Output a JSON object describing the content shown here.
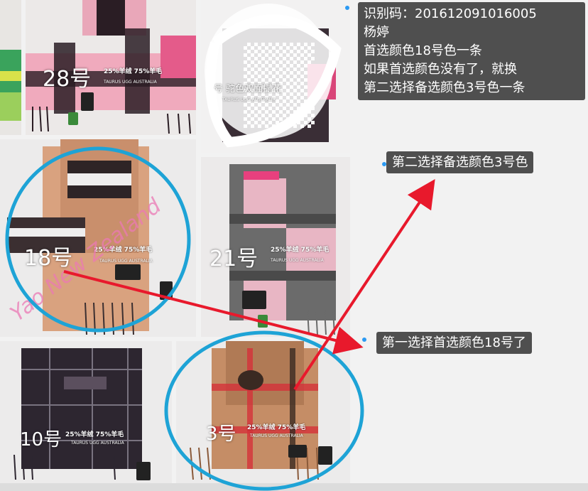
{
  "products": [
    {
      "id": "p28",
      "number": "28号",
      "spec": "25%羊绒 75%羊毛",
      "brand": "TAURUS UGG AUSTRALIA"
    },
    {
      "id": "p-top-right",
      "number": "号",
      "spec": "驼色双面提花",
      "brand": "TAURUS UGG AUSTRALIA"
    },
    {
      "id": "p18",
      "number": "18号",
      "spec": "25%羊绒 75%羊毛",
      "brand": "TAURUS UGG AUSTRALIA"
    },
    {
      "id": "p21",
      "number": "21号",
      "spec": "25%羊绒 75%羊毛",
      "brand": "TAURUS UGG AUSTRALIA"
    },
    {
      "id": "p10",
      "number": "10号",
      "spec": "25%羊绒 75%羊毛",
      "brand": "TAURUS UGG AUSTRALIA"
    },
    {
      "id": "p3",
      "number": "3号",
      "spec": "25%羊绒 75%羊毛",
      "brand": "TAURUS UGG AUSTRALIA"
    }
  ],
  "watermark": "Yao New Zealand",
  "bubbles": {
    "main": [
      "识别码：201612091016005",
      "杨婷",
      "首选颜色18号色一条",
      "如果首选颜色没有了，就换",
      "第二选择备选颜色3号色一条"
    ],
    "second": "第二选择备选颜色3号色",
    "first": "第一选择首选颜色18号了"
  },
  "colors": {
    "circle": "#1ea3d6",
    "arrow": "#e8192c",
    "bubble": "#4f4f4f",
    "dot": "#2b9af3"
  }
}
